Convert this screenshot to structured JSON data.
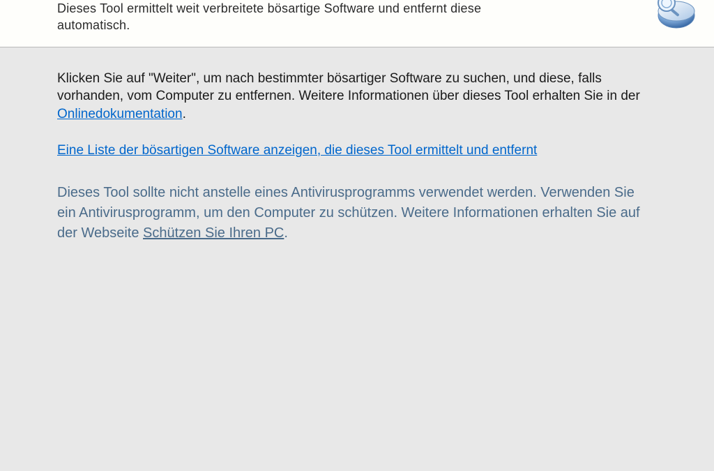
{
  "header": {
    "subtitle_line1": "Dieses Tool ermittelt weit verbreitete bösartige Software und entfernt diese",
    "subtitle_line2": "automatisch."
  },
  "main": {
    "intro_pre": "Klicken Sie auf \"Weiter\", um nach bestimmter bösartiger Software zu suchen, und diese, falls vorhanden, vom Computer zu entfernen. Weitere Informationen über dieses Tool erhalten Sie in der ",
    "intro_link": "Onlinedokumentation",
    "intro_post": ".",
    "list_link": "Eine Liste der bösartigen Software anzeigen, die dieses Tool ermittelt und entfernt",
    "note_pre": "Dieses Tool sollte nicht anstelle eines Antivirusprogramms verwendet werden. Verwenden Sie ein Antivirusprogramm, um den Computer zu schützen. Weitere Informationen erhalten Sie auf der Webseite ",
    "note_link": "Schützen Sie Ihren PC",
    "note_post": "."
  }
}
